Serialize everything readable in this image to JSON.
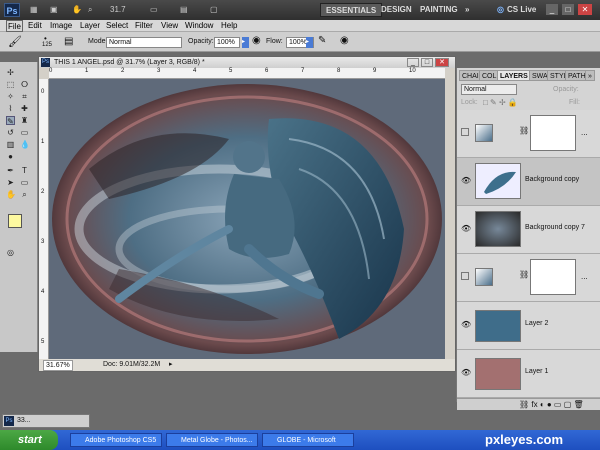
{
  "app": {
    "logo": "Ps",
    "zoom": "31.7",
    "cslive": "CS Live"
  },
  "workspaces": [
    "ESSENTIALS",
    "DESIGN",
    "PAINTING",
    "»"
  ],
  "menu": [
    "File",
    "Edit",
    "Image",
    "Layer",
    "Select",
    "Filter",
    "View",
    "Window",
    "Help"
  ],
  "options": {
    "brush_size": "125",
    "mode_label": "Mode:",
    "mode_value": "Normal",
    "opacity_label": "Opacity:",
    "opacity_value": "100%",
    "flow_label": "Flow:",
    "flow_value": "100%"
  },
  "document": {
    "title": "THIS 1 ANGEL.psd @ 31.7% (Layer 3, RGB/8) *",
    "zoom": "31.67%",
    "doc_info": "Doc: 9.01M/32.2M"
  },
  "ruler": {
    "top": [
      "0",
      "1",
      "2",
      "3",
      "4",
      "5",
      "6",
      "7",
      "8",
      "9",
      "10"
    ],
    "left": [
      "0",
      "1",
      "2",
      "3",
      "4",
      "5"
    ]
  },
  "panel": {
    "tabs": [
      "CHAI",
      "COL",
      "LAYERS",
      "SWA",
      "STYL",
      "PATH",
      "»"
    ],
    "blend": "Normal",
    "opacity_label": "Opacity:",
    "fill_label": "Fill:",
    "lock_label": "Lock:",
    "layers": [
      {
        "name": "",
        "kind": "adjust"
      },
      {
        "name": "Background copy",
        "kind": "image"
      },
      {
        "name": "Background copy 7",
        "kind": "globe"
      },
      {
        "name": "",
        "kind": "adjust"
      },
      {
        "name": "Layer 2",
        "kind": "color",
        "color": "#3f6d8a"
      },
      {
        "name": "Layer 1",
        "kind": "color",
        "color": "#a37070"
      }
    ]
  },
  "taskbar": {
    "start": "start",
    "tasks": [
      "Adobe Photoshop CS5",
      "Metal Globe - Photos...",
      "GLOBE - Microsoft Word"
    ],
    "watermark": "pxleyes.com"
  },
  "minimized": "33..."
}
